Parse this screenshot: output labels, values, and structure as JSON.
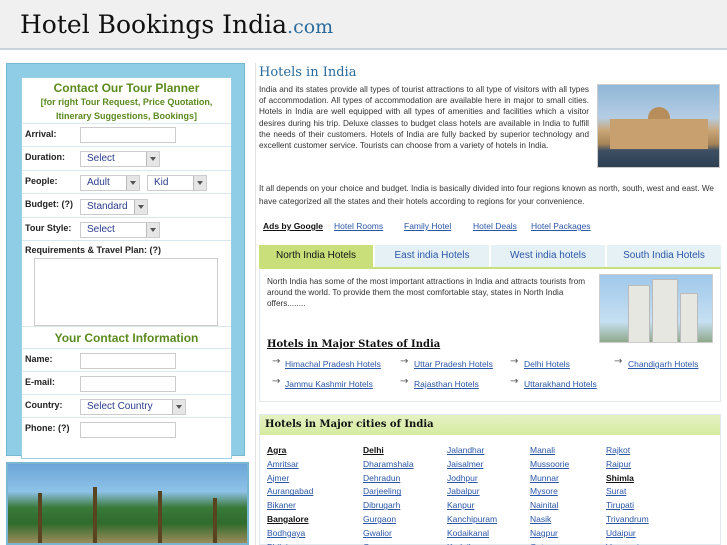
{
  "header": {
    "title_main": "Hotel Bookings India",
    "title_ext": ".com"
  },
  "form": {
    "heading": "Contact Our Tour Planner",
    "subheading_line1": "[for right Tour Request, Price Quotation,",
    "subheading_line2": "Itinerary Suggestions, Bookings]",
    "arrival_label": "Arrival:",
    "duration_label": "Duration:",
    "duration_value": "Select",
    "people_label": "People:",
    "adult_value": "Adult",
    "kid_value": "Kid",
    "budget_label": "Budget: (?)",
    "budget_value": "Standard",
    "tour_style_label": "Tour Style:",
    "tour_style_value": "Select",
    "requirements_label": "Requirements & Travel Plan: (?)",
    "contact_heading": "Your Contact Information",
    "name_label": "Name:",
    "email_label": "E-mail:",
    "country_label": "Country:",
    "country_value": "Select Country",
    "phone_label": "Phone: (?)"
  },
  "main": {
    "section_title": "Hotels in India",
    "intro": "India and its states provide all types of tourist attractions to all type of visitors with all types of accommodation. All types of accommodation are available here in major to small cities. Hotels in India are well equipped with all types of amenities and facilities which a visitor desires during his trip. Deluxe classes to budget class hotels are available in India to fulfill the needs of their customers. Hotels of India are fully backed by superior technology and excellent customer service. Tourists can choose from a variety of hotels in India.",
    "intro2": "It all depends on your choice and budget. India is basically divided into four regions known as north, south, west and east. We have categorized all the states and their hotels according to regions for your convenience."
  },
  "ads": {
    "ads_by": "Ads by Google",
    "links": [
      "Hotel Rooms",
      "Family Hotel",
      "Hotel Deals",
      "Hotel Packages"
    ]
  },
  "tabs": [
    "North India Hotels",
    "East india Hotels",
    "West india hotels",
    "South India Hotels"
  ],
  "north": {
    "text": "North India has some of the most important attractions in India and attracts tourists from around the world. To provide them the most comfortable stay, states in North India offers........",
    "states_title": "Hotels in Major States of India",
    "states": [
      "Himachal Pradesh Hotels",
      "Uttar Pradesh Hotels",
      "Delhi Hotels",
      "Chandigarh Hotels",
      "Jammu Kashmir Hotels",
      "Rajasthan Hotels",
      "Uttarakhand Hotels"
    ]
  },
  "cities": {
    "title": "Hotels in Major cities of India",
    "col1": [
      "Agra",
      "Amritsar",
      "Ajmer",
      "Aurangabad",
      "Bikaner",
      "Bangalore",
      "Bodhgaya",
      "Bhilai"
    ],
    "col2": [
      "Delhi",
      "Dharamshala",
      "Dehradun",
      "Darjeeling",
      "Dibrugarh",
      "Gurgaon",
      "Gwalior",
      "Goa"
    ],
    "col3": [
      "Jalandhar",
      "Jaisalmer",
      "Jodhpur",
      "Jabalpur",
      "Kanpur",
      "Kanchipuram",
      "Kodaikanal",
      "Kodaiku"
    ],
    "col4": [
      "Manali",
      "Mussoorie",
      "Munnar",
      "Mysore",
      "Nainital",
      "Nasik",
      "Nagpur",
      "Ooty"
    ],
    "col5": [
      "Rajkot",
      "Raipur",
      "Shimla",
      "Surat",
      "Tirupati",
      "Trivandrum",
      "Udaipur",
      "Varanasi"
    ]
  },
  "colors": {
    "accent_blue": "#2a6b9c",
    "link": "#2a56a6",
    "active_tab": "#c9e07a",
    "panel_blue": "#8fcde6"
  }
}
